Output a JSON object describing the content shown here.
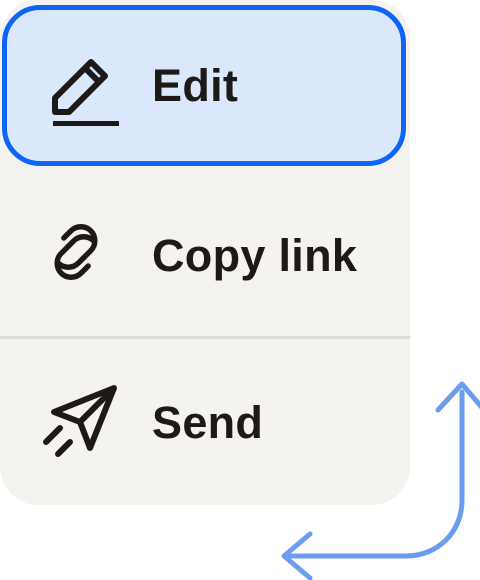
{
  "menu": {
    "items": [
      {
        "label": "Edit",
        "icon": "pencil-icon",
        "state": "focused"
      },
      {
        "label": "Copy link",
        "icon": "link-icon"
      },
      {
        "label": "Send",
        "icon": "paper-plane-icon"
      }
    ]
  },
  "colors": {
    "focus_border": "#0d64f5",
    "focus_fill": "#dbe8fc",
    "menu_bg": "#f4f3ef",
    "divider": "#dedcd8",
    "text": "#1e1919",
    "arrow": "#6a9df0"
  },
  "decoration": {
    "icon": "corner-double-arrow-icon"
  }
}
